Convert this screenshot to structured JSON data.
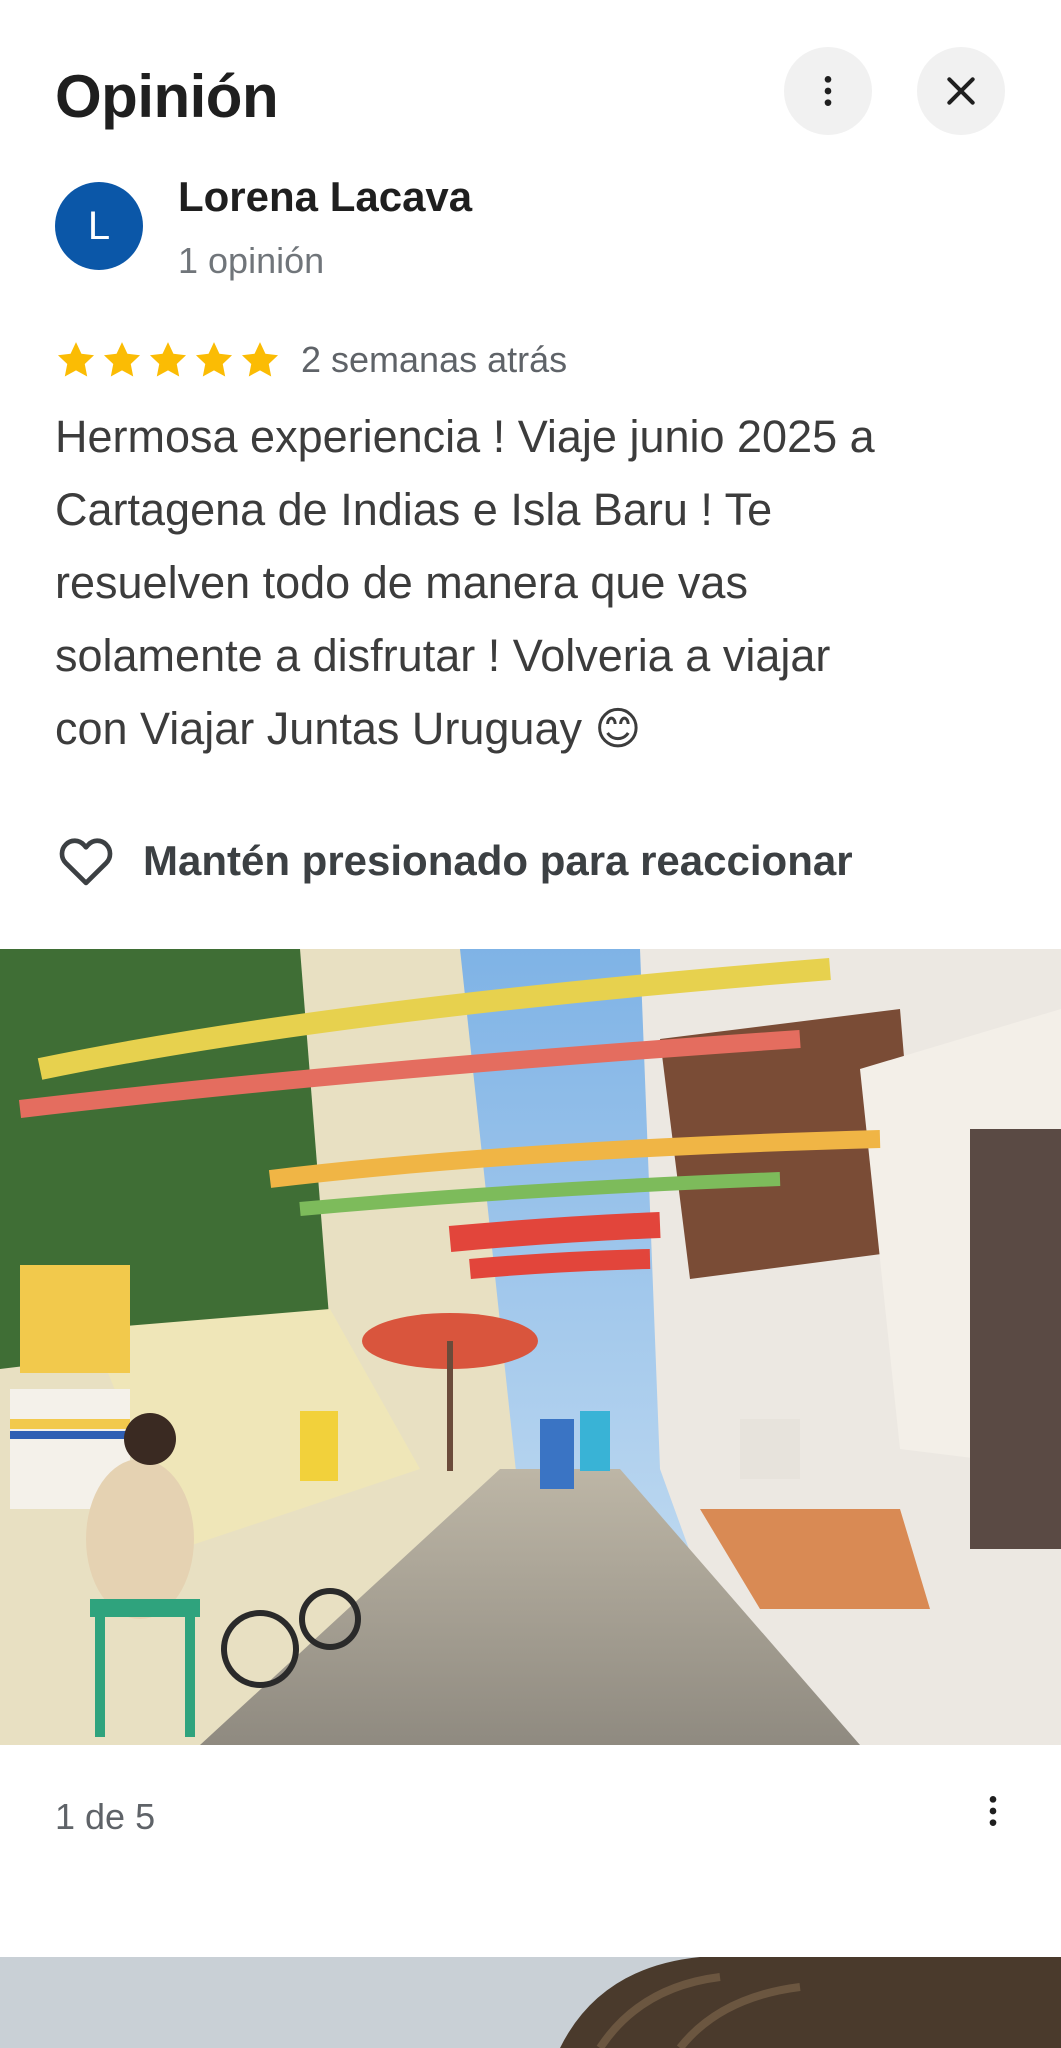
{
  "header": {
    "title": "Opinión",
    "more_icon": "more-vert-icon",
    "close_icon": "close-icon"
  },
  "review": {
    "author_initial": "L",
    "author_name": "Lorena Lacava",
    "author_meta": "1 opinión",
    "rating": 5,
    "max_rating": 5,
    "time_ago": "2 semanas atrás",
    "text": "Hermosa experiencia !  Viaje junio 2025 a\nCartagena de Indias e Isla Baru ! Te\nresuelven todo de manera que vas\nsolamente  a disfrutar ! Volveria a viajar\ncon  Viajar Juntas Uruguay 😊",
    "react_label": "Mantén presionado para reaccionar"
  },
  "photos": {
    "counter": "1 de 5"
  },
  "colors": {
    "avatar": "#0b57a8",
    "star": "#fbbc04",
    "button_bg": "#f1f1f1"
  }
}
